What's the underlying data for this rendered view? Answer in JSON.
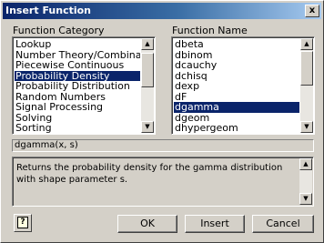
{
  "window": {
    "title": "Insert Function",
    "close_glyph": "x"
  },
  "category": {
    "label": "Function Category",
    "items": [
      "Lookup",
      "Number Theory/Combinatorics",
      "Piecewise Continuous",
      "Probability Density",
      "Probability Distribution",
      "Random Numbers",
      "Signal Processing",
      "Solving",
      "Sorting"
    ],
    "selected": "Probability Density"
  },
  "function": {
    "label": "Function Name",
    "items": [
      "dbeta",
      "dbinom",
      "dcauchy",
      "dchisq",
      "dexp",
      "dF",
      "dgamma",
      "dgeom",
      "dhypergeom"
    ],
    "selected": "dgamma"
  },
  "syntax": "dgamma(x, s)",
  "description": "Returns the probability density for the gamma distribution with shape parameter s.",
  "buttons": {
    "ok": "OK",
    "insert": "Insert",
    "cancel": "Cancel"
  },
  "help": {
    "glyph": "?"
  }
}
